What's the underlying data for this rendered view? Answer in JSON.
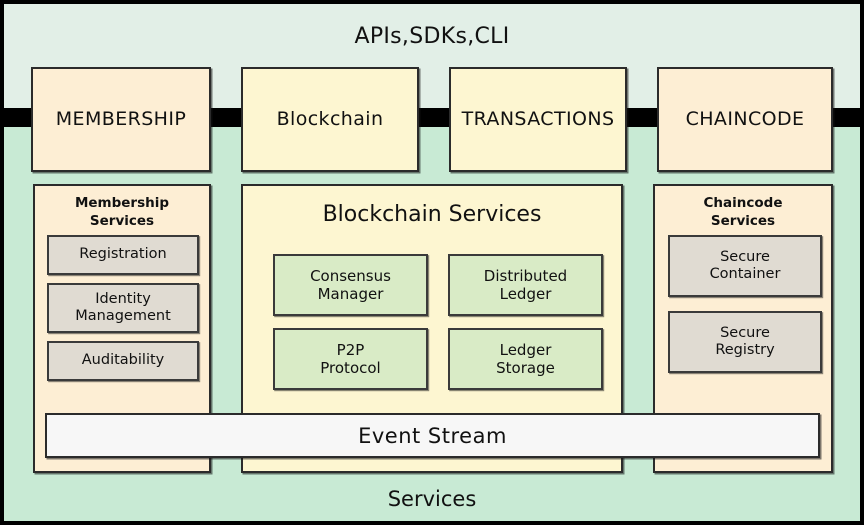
{
  "diagram": {
    "title": "APIs,SDKs,CLI",
    "footer_label": "Services",
    "colors": {
      "band_top": "#e2efe7",
      "band_bottom": "#c8ead4",
      "divider_bar": "#000000",
      "pillar_peach": "#fdeed4",
      "pillar_yellow": "#fdf6d1",
      "chip_grey": "#e0dbd2",
      "chip_green": "#d9ebc6",
      "event_stream": "#f7f7f7",
      "outline": "#2b2b2b"
    }
  },
  "pillars": [
    {
      "label": "MEMBERSHIP"
    },
    {
      "label": "Blockchain"
    },
    {
      "label": "TRANSACTIONS"
    },
    {
      "label": "CHAINCODE"
    }
  ],
  "panels": {
    "membership": {
      "title": "Membership\nServices",
      "title_line1": "Membership",
      "title_line2": "Services",
      "chips": [
        {
          "label": "Registration"
        },
        {
          "label": "Identity\nManagement",
          "line1": "Identity",
          "line2": "Management"
        },
        {
          "label": "Auditability"
        }
      ]
    },
    "blockchain": {
      "title": "Blockchain Services",
      "chips": [
        {
          "label": "Consensus\nManager",
          "line1": "Consensus",
          "line2": "Manager"
        },
        {
          "label": "Distributed\nLedger",
          "line1": "Distributed",
          "line2": "Ledger"
        },
        {
          "label": "P2P\nProtocol",
          "line1": "P2P",
          "line2": "Protocol"
        },
        {
          "label": "Ledger\nStorage",
          "line1": "Ledger",
          "line2": "Storage"
        }
      ]
    },
    "chaincode": {
      "title_line1": "Chaincode",
      "title_line2": "Services",
      "chips": [
        {
          "label": "Secure\nContainer",
          "line1": "Secure",
          "line2": "Container"
        },
        {
          "label": "Secure\nRegistry",
          "line1": "Secure",
          "line2": "Registry"
        }
      ]
    }
  },
  "event_stream": {
    "label": "Event Stream"
  }
}
